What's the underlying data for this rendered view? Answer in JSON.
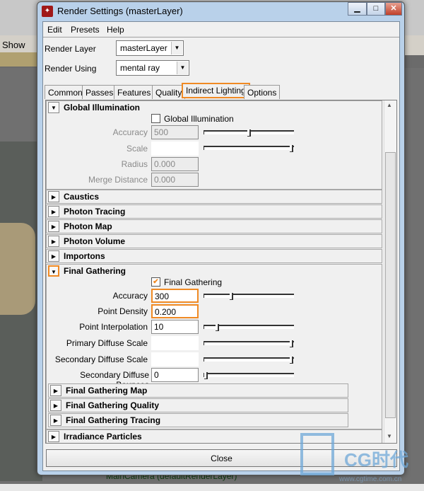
{
  "background": {
    "show_label": "Show",
    "camera_label": "MainCamera (defaultRenderLayer)"
  },
  "window": {
    "title": "Render Settings (masterLayer)",
    "minimize": "▁",
    "maximize": "□",
    "close": "✕"
  },
  "menu": [
    "Edit",
    "Presets",
    "Help"
  ],
  "render_layer": {
    "label": "Render Layer",
    "value": "masterLayer"
  },
  "render_using": {
    "label": "Render Using",
    "value": "mental ray"
  },
  "tabs": [
    "Common",
    "Passes",
    "Features",
    "Quality",
    "Indirect Lighting",
    "Options"
  ],
  "active_tab": "Indirect Lighting",
  "accent_color": "#f08a24",
  "global_illumination": {
    "title": "Global Illumination",
    "expanded": true,
    "checkbox_label": "Global Illumination",
    "checked": false,
    "accuracy": {
      "label": "Accuracy",
      "value": "500",
      "slider": 0.5
    },
    "scale": {
      "label": "Scale",
      "slider": 1.0
    },
    "radius": {
      "label": "Radius",
      "value": "0.000"
    },
    "merge_distance": {
      "label": "Merge Distance",
      "value": "0.000"
    }
  },
  "sections": [
    "Caustics",
    "Photon Tracing",
    "Photon Map",
    "Photon Volume",
    "Importons"
  ],
  "final_gathering": {
    "title": "Final Gathering",
    "expanded": true,
    "checkbox_label": "Final Gathering",
    "checked": true,
    "accuracy": {
      "label": "Accuracy",
      "value": "300",
      "slider": 0.3
    },
    "point_density": {
      "label": "Point Density",
      "value": "0.200"
    },
    "point_interpolation": {
      "label": "Point Interpolation",
      "value": "10",
      "slider": 0.13
    },
    "primary_diffuse_scale": {
      "label": "Primary Diffuse Scale",
      "slider": 1.0
    },
    "secondary_diffuse_scale": {
      "label": "Secondary Diffuse Scale",
      "slider": 1.0
    },
    "secondary_diffuse_bounces": {
      "label": "Secondary Diffuse Bounces",
      "value": "0",
      "slider": 0.0
    },
    "subsections": [
      "Final Gathering Map",
      "Final Gathering Quality",
      "Final Gathering Tracing"
    ]
  },
  "irradiance_particles": "Irradiance Particles",
  "close_button": "Close",
  "watermark": {
    "text": "CG时代",
    "url": "www.cgtime.com.cn"
  }
}
